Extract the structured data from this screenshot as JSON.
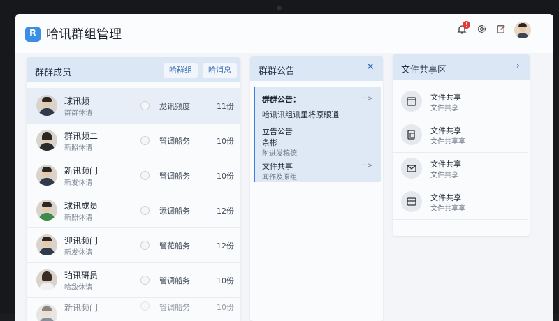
{
  "app": {
    "title": "哈讯群组管理",
    "logo_letter": "R"
  },
  "topbar": {
    "icons": [
      "bell-icon",
      "gear-icon",
      "edit-icon"
    ],
    "notification_badge": "!"
  },
  "members_panel": {
    "title": "群群成员",
    "tab_1": "哈群组",
    "tab_2": "哈消息",
    "rows": [
      {
        "name": "球讯频",
        "sub": "群群休请",
        "status": "龙讯频度",
        "count": "11份"
      },
      {
        "name": "群讯频二",
        "sub": "新照休请",
        "status": "管调船务",
        "count": "10份"
      },
      {
        "name": "新讯频门",
        "sub": "新发休请",
        "status": "管调船务",
        "count": "10份"
      },
      {
        "name": "球讯成员",
        "sub": "新照休请",
        "status": "添调船务",
        "count": "12份"
      },
      {
        "name": "迎讯频门",
        "sub": "新发休请",
        "status": "管花船务",
        "count": "12份"
      },
      {
        "name": "珀讯研员",
        "sub": "哈敌休请",
        "status": "管调船务",
        "count": "10份"
      },
      {
        "name": "新讯频门",
        "sub": "",
        "status": "管调船务",
        "count": "10份"
      }
    ]
  },
  "announce_panel": {
    "title": "群群公告",
    "card_title": "群群公告：",
    "line_1": "哈讯讯组讯里将原眼通",
    "item_1_title": "立告公告",
    "item_1_a": "条彬",
    "item_1_b": "附进发稿德",
    "item_2_title": "文件共享",
    "item_2_b": "闻作及原组",
    "arrow": "··>"
  },
  "files_panel": {
    "title": "文件共享区",
    "rows": [
      {
        "name": "文件共享",
        "sub": "文件共享",
        "icon": "calendar-icon"
      },
      {
        "name": "文件共享",
        "sub": "文件共享享",
        "icon": "document-icon"
      },
      {
        "name": "文件共享",
        "sub": "文件共享",
        "icon": "mail-icon"
      },
      {
        "name": "文件共享",
        "sub": "文件共享享",
        "icon": "card-icon"
      }
    ]
  },
  "colors": {
    "accent": "#3a8ee6",
    "panel_header": "#dbe7f5",
    "selected_row": "#e7eef7"
  }
}
